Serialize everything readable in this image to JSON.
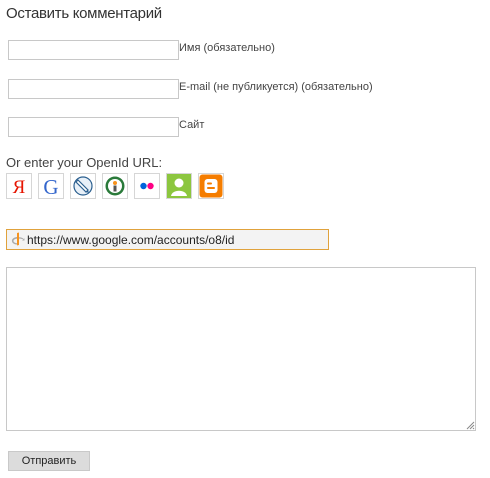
{
  "form": {
    "title": "Оставить комментарий",
    "fields": [
      {
        "name_label": "Имя (обязательно)",
        "value": ""
      },
      {
        "name_label": "E-mail (не публикуется) (обязательно)",
        "value": ""
      },
      {
        "name_label": "Сайт",
        "value": ""
      }
    ],
    "openid": {
      "title": "Or enter your OpenId URL:",
      "providers": [
        "yandex",
        "google",
        "livejournal",
        "openid",
        "flickr",
        "myopenid",
        "blogger"
      ],
      "url_value": "https://www.google.com/accounts/o8/id"
    },
    "comment_value": "",
    "submit_label": "Отправить"
  },
  "colors": {
    "openid_border": "#e0a23c",
    "yandex_red": "#e61400",
    "blogger_orange": "#f57d00",
    "flickr_blue": "#0063dc",
    "flickr_pink": "#ff0084",
    "myopenid_green": "#8cc63f"
  }
}
